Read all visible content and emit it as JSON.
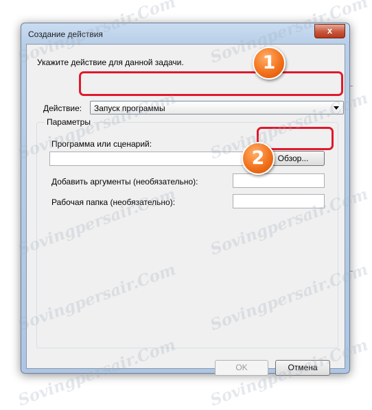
{
  "window": {
    "title": "Создание действия",
    "close_glyph": "x"
  },
  "instruction": "Укажите действие для данной задачи.",
  "action": {
    "label": "Действие:",
    "selected": "Запуск программы"
  },
  "parameters": {
    "group_label": "Параметры",
    "program_label": "Программа или сценарий:",
    "program_value": "",
    "browse_label": "Обзор...",
    "args_label": "Добавить аргументы (необязательно):",
    "args_value": "",
    "workdir_label": "Рабочая папка (необязательно):",
    "workdir_value": ""
  },
  "buttons": {
    "ok": "OK",
    "cancel": "Отмена"
  },
  "callouts": {
    "one": "1",
    "two": "2"
  },
  "watermark": "Sovingpersair.Com",
  "colors": {
    "highlight": "#e0182b",
    "callout": "#f2721c"
  }
}
